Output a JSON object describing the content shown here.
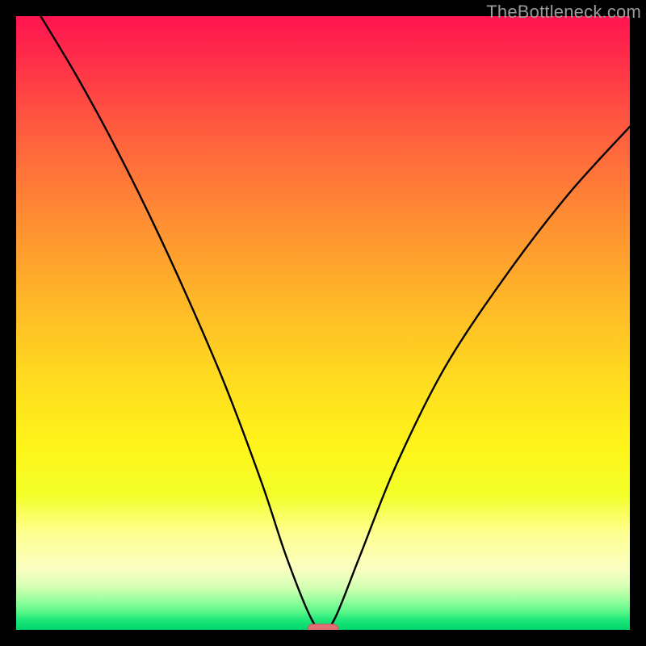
{
  "watermark": "TheBottleneck.com",
  "colors": {
    "frame": "#000000",
    "curve_stroke": "#000000",
    "marker_fill": "#e07074",
    "marker_stroke": "#cc5a60"
  },
  "chart_data": {
    "type": "line",
    "title": "",
    "xlabel": "",
    "ylabel": "",
    "xlim": [
      0,
      1
    ],
    "ylim": [
      0,
      1
    ],
    "x": [
      0.04,
      0.1,
      0.16,
      0.22,
      0.28,
      0.34,
      0.4,
      0.44,
      0.48,
      0.5,
      0.52,
      0.56,
      0.62,
      0.7,
      0.8,
      0.9,
      1.0
    ],
    "values": [
      1.0,
      0.9,
      0.79,
      0.67,
      0.54,
      0.4,
      0.24,
      0.12,
      0.02,
      0.0,
      0.02,
      0.12,
      0.27,
      0.43,
      0.58,
      0.71,
      0.82
    ],
    "marker": {
      "x_center": 0.5,
      "x_half_width": 0.025,
      "y": 0.0
    },
    "notes": "V-shaped bottleneck curve over red→green vertical gradient. Values estimated from pixel positions; y=0 is the green bottom, y=1 is the top edge."
  }
}
